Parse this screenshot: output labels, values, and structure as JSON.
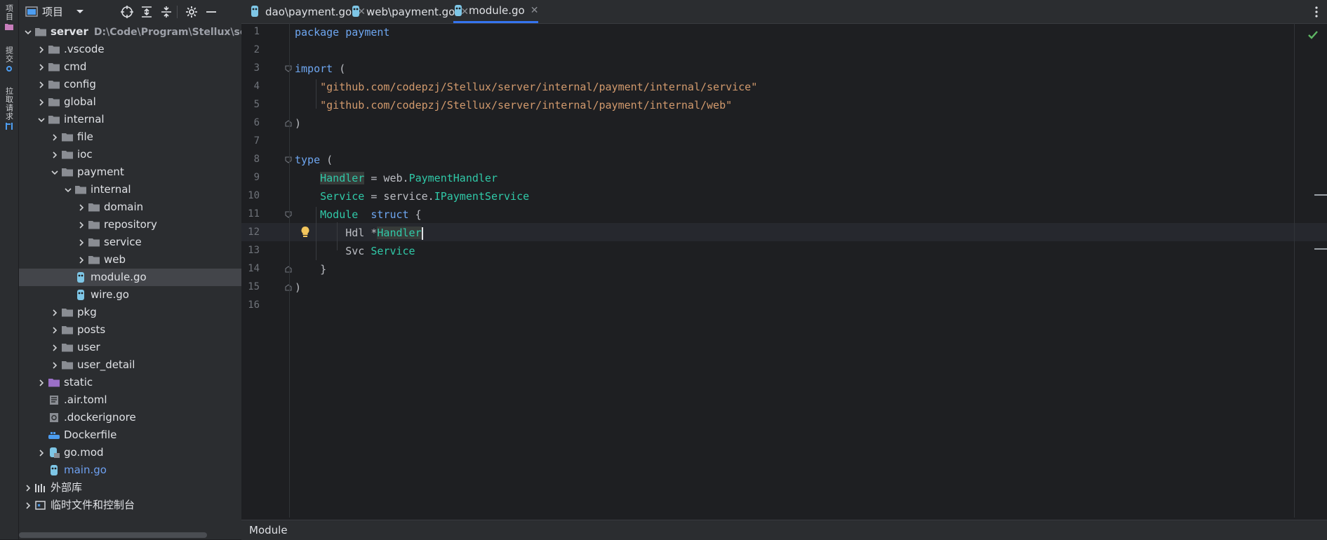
{
  "toolstrip": {
    "project": "项目",
    "commit": "提交",
    "pull_requests": "拉取请求"
  },
  "project_panel": {
    "title": "项目",
    "tree": [
      {
        "name": "server",
        "path": "D:\\Code\\Program\\Stellux\\server",
        "depth": 0,
        "kind": "folder",
        "expanded": true,
        "bold": true
      },
      {
        "name": ".vscode",
        "depth": 1,
        "kind": "folder",
        "expanded": false
      },
      {
        "name": "cmd",
        "depth": 1,
        "kind": "folder",
        "expanded": false
      },
      {
        "name": "config",
        "depth": 1,
        "kind": "folder",
        "expanded": false
      },
      {
        "name": "global",
        "depth": 1,
        "kind": "folder",
        "expanded": false
      },
      {
        "name": "internal",
        "depth": 1,
        "kind": "folder",
        "expanded": true
      },
      {
        "name": "file",
        "depth": 2,
        "kind": "folder",
        "expanded": false
      },
      {
        "name": "ioc",
        "depth": 2,
        "kind": "folder",
        "expanded": false
      },
      {
        "name": "payment",
        "depth": 2,
        "kind": "folder",
        "expanded": true
      },
      {
        "name": "internal",
        "depth": 3,
        "kind": "folder",
        "expanded": true
      },
      {
        "name": "domain",
        "depth": 4,
        "kind": "folder",
        "expanded": false
      },
      {
        "name": "repository",
        "depth": 4,
        "kind": "folder",
        "expanded": false
      },
      {
        "name": "service",
        "depth": 4,
        "kind": "folder",
        "expanded": false
      },
      {
        "name": "web",
        "depth": 4,
        "kind": "folder",
        "expanded": false
      },
      {
        "name": "module.go",
        "depth": 3,
        "kind": "gofile",
        "selected": true
      },
      {
        "name": "wire.go",
        "depth": 3,
        "kind": "gofile"
      },
      {
        "name": "pkg",
        "depth": 2,
        "kind": "folder",
        "expanded": false
      },
      {
        "name": "posts",
        "depth": 2,
        "kind": "folder",
        "expanded": false
      },
      {
        "name": "user",
        "depth": 2,
        "kind": "folder",
        "expanded": false
      },
      {
        "name": "user_detail",
        "depth": 2,
        "kind": "folder",
        "expanded": false
      },
      {
        "name": "static",
        "depth": 1,
        "kind": "folder-purple",
        "expanded": false
      },
      {
        "name": ".air.toml",
        "depth": 1,
        "kind": "toml"
      },
      {
        "name": ".dockerignore",
        "depth": 1,
        "kind": "ignore"
      },
      {
        "name": "Dockerfile",
        "depth": 1,
        "kind": "docker"
      },
      {
        "name": "go.mod",
        "depth": 1,
        "kind": "gomod",
        "expanded": false
      },
      {
        "name": "main.go",
        "depth": 1,
        "kind": "gofile",
        "blue": true
      },
      {
        "name": "外部库",
        "depth": 0,
        "kind": "library",
        "expanded": false
      },
      {
        "name": "临时文件和控制台",
        "depth": 0,
        "kind": "scratch",
        "expanded": false
      }
    ]
  },
  "tabs": [
    {
      "label": "dao\\payment.go",
      "active": false
    },
    {
      "label": "web\\payment.go",
      "active": false
    },
    {
      "label": "module.go",
      "active": true
    }
  ],
  "code": {
    "lines": [
      [
        [
          "kw",
          "package"
        ],
        [
          "p",
          " "
        ],
        [
          "kw",
          "payment"
        ]
      ],
      [],
      [
        [
          "kw",
          "import"
        ],
        [
          "p",
          " ("
        ]
      ],
      [
        [
          "p",
          "    "
        ],
        [
          "str",
          "\"github.com/codepzj/Stellux/server/internal/payment/internal/service\""
        ]
      ],
      [
        [
          "p",
          "    "
        ],
        [
          "str",
          "\"github.com/codepzj/Stellux/server/internal/payment/internal/web\""
        ]
      ],
      [
        [
          "p",
          ")"
        ]
      ],
      [],
      [
        [
          "kw",
          "type"
        ],
        [
          "p",
          " ("
        ]
      ],
      [
        [
          "p",
          "    "
        ],
        [
          "typ-hl",
          "Handler"
        ],
        [
          "p",
          " = web."
        ],
        [
          "typ",
          "PaymentHandler"
        ]
      ],
      [
        [
          "p",
          "    "
        ],
        [
          "typ",
          "Service"
        ],
        [
          "p",
          " = service."
        ],
        [
          "typ",
          "IPaymentService"
        ]
      ],
      [
        [
          "p",
          "    "
        ],
        [
          "typ",
          "Module"
        ],
        [
          "p",
          "  "
        ],
        [
          "kw",
          "struct"
        ],
        [
          "p",
          " {"
        ]
      ],
      [
        [
          "p",
          "        Hdl *"
        ],
        [
          "typ-hl",
          "Handler"
        ],
        [
          "caret",
          ""
        ]
      ],
      [
        [
          "p",
          "        Svc "
        ],
        [
          "typ",
          "Service"
        ]
      ],
      [
        [
          "p",
          "    }"
        ]
      ],
      [
        [
          "p",
          ")"
        ]
      ],
      []
    ]
  },
  "breadcrumb": {
    "item": "Module"
  }
}
